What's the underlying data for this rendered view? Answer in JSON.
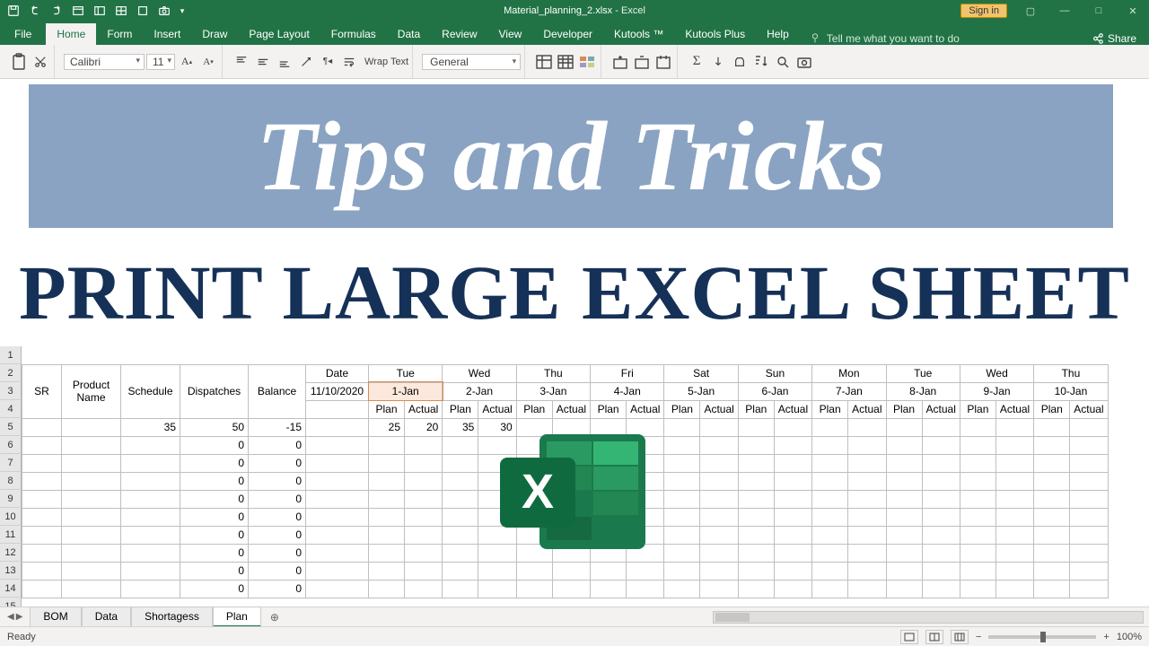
{
  "titlebar": {
    "filename": "Material_planning_2.xlsx",
    "appname": "Excel",
    "signin": "Sign in"
  },
  "tabs": {
    "file": "File",
    "home": "Home",
    "form": "Form",
    "insert": "Insert",
    "draw": "Draw",
    "page_layout": "Page Layout",
    "formulas": "Formulas",
    "data": "Data",
    "review": "Review",
    "view": "View",
    "developer": "Developer",
    "kutools": "Kutools ™",
    "kutools_plus": "Kutools Plus",
    "help": "Help",
    "tell_me": "Tell me what you want to do",
    "share": "Share"
  },
  "ribbon": {
    "font_name": "Calibri",
    "font_size": "11",
    "wrap_text": "Wrap Text",
    "number_format": "General"
  },
  "overlay": {
    "banner1": "Tips and Tricks",
    "banner2": "PRINT LARGE EXCEL SHEET"
  },
  "sheet": {
    "row_start": 1,
    "row_end": 15,
    "headers": {
      "sr": "SR",
      "product": "Product Name",
      "schedule": "Schedule",
      "dispatches": "Dispatches",
      "balance": "Balance",
      "date_label": "Date",
      "date_value": "11/10/2020",
      "plan": "Plan",
      "actual": "Actual"
    },
    "days": [
      {
        "dow": "Tue",
        "date": "1-Jan"
      },
      {
        "dow": "Wed",
        "date": "2-Jan"
      },
      {
        "dow": "Thu",
        "date": "3-Jan"
      },
      {
        "dow": "Fri",
        "date": "4-Jan"
      },
      {
        "dow": "Sat",
        "date": "5-Jan"
      },
      {
        "dow": "Sun",
        "date": "6-Jan"
      },
      {
        "dow": "Mon",
        "date": "7-Jan"
      },
      {
        "dow": "Tue",
        "date": "8-Jan"
      },
      {
        "dow": "Wed",
        "date": "9-Jan"
      },
      {
        "dow": "Thu",
        "date": "10-Jan"
      }
    ],
    "first_data_row": {
      "schedule": 35,
      "dispatches": 50,
      "balance": -15,
      "plan1": 25,
      "actual1": 20,
      "plan2": 35,
      "actual2": 30
    },
    "zero_rows": 9
  },
  "sheet_tabs": {
    "tabs": [
      "BOM",
      "Data",
      "Shortagess",
      "Plan"
    ],
    "active": "Plan"
  },
  "status": {
    "ready": "Ready",
    "zoom": "100%"
  }
}
